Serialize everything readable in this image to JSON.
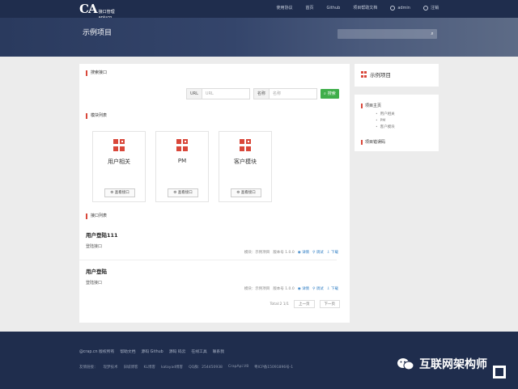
{
  "nav": {
    "logo_ca": "CA",
    "logo_cn": "接口管理",
    "logo_en": "apiucp",
    "links": [
      "使用协议",
      "首页",
      "Github",
      "项目帮助文档",
      "admin",
      "注销"
    ]
  },
  "banner": {
    "title": "示例项目",
    "search_placeholder": ""
  },
  "main": {
    "search_section_title": "搜索接口",
    "url_label": "URL",
    "url_placeholder": "URL",
    "name_label": "名称",
    "name_placeholder": "名称",
    "search_button": "搜索",
    "modules_title": "模块列表",
    "modules": [
      {
        "name": "用户相关",
        "button": "查看接口"
      },
      {
        "name": "PM",
        "button": "查看接口"
      },
      {
        "name": "客户模块",
        "button": "查看接口"
      }
    ],
    "interfaces_title": "接口列表",
    "interfaces": [
      {
        "title": "用户登陆111",
        "desc": "登陆接口",
        "module": "模块：示例项目",
        "version": "版本号 1.0.0",
        "detail": "详情",
        "debug": "调试",
        "download": "下载"
      },
      {
        "title": "用户登陆",
        "desc": "登陆接口",
        "module": "模块：示例项目",
        "version": "版本号 1.0.0",
        "detail": "详情",
        "debug": "调试",
        "download": "下载"
      }
    ],
    "pager": {
      "total": "Total:2  1/1",
      "prev": "上一页",
      "next": "下一页"
    }
  },
  "sidebar": {
    "project_title": "示例项目",
    "home_label": "项目主页",
    "items": [
      "用户相关",
      "PM",
      "客户模块"
    ],
    "error_codes_label": "项目错误码"
  },
  "footer": {
    "row1": [
      "@crap.cn 版权所有",
      "帮助文档",
      "源码 Github",
      "源码 码云",
      "在线工具",
      "联系我"
    ],
    "row2": [
      "友情链接：",
      "现梦技术",
      "旧城博客",
      "KL博客",
      "katayad博客",
      "QQ群：254450938",
      "CrapApi.V8",
      "粤ICP备15091896号-1"
    ]
  },
  "watermark": {
    "text": "互联网架构师"
  },
  "colors": {
    "nav_bg": "#1f2d4d",
    "accent_red": "#d9473a",
    "search_green": "#3fae4a",
    "link_blue": "#2f7ec4"
  }
}
